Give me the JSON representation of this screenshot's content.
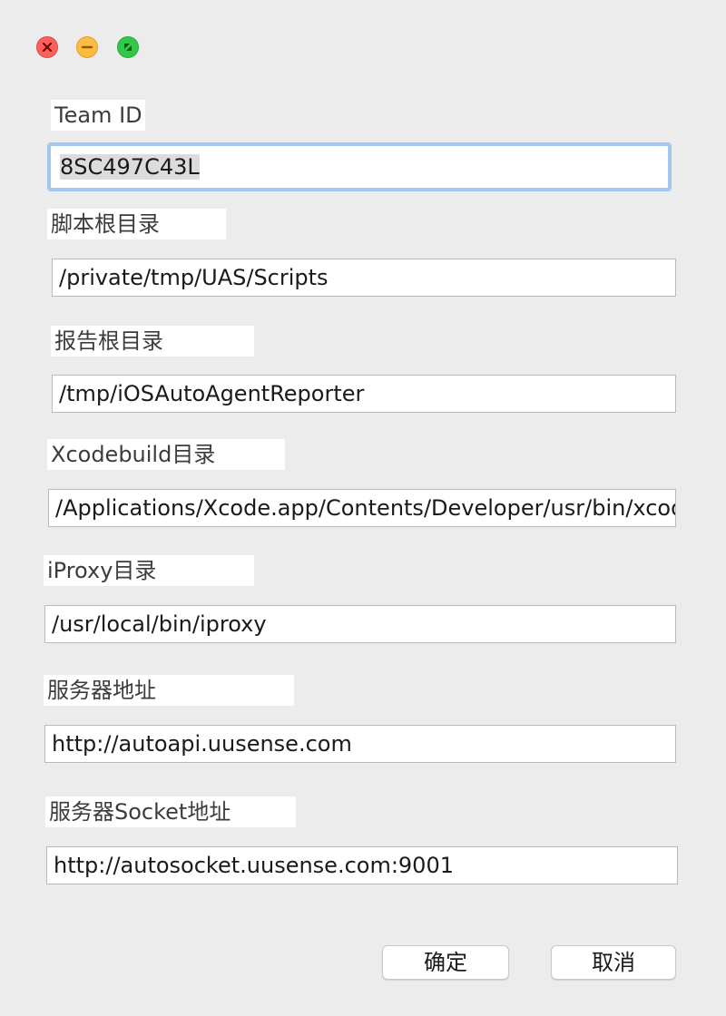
{
  "window": {
    "controls": {
      "close_icon": "close-icon",
      "minimize_icon": "minimize-icon",
      "maximize_icon": "maximize-icon"
    }
  },
  "form": {
    "team_id": {
      "label": "Team ID",
      "value": "8SC497C43L"
    },
    "script_root": {
      "label": "脚本根目录",
      "value": "/private/tmp/UAS/Scripts"
    },
    "report_root": {
      "label": "报告根目录",
      "value": "/tmp/iOSAutoAgentReporter"
    },
    "xcodebuild_dir": {
      "label": "Xcodebuild目录",
      "value": "/Applications/Xcode.app/Contents/Developer/usr/bin/xcodebuild"
    },
    "iproxy_dir": {
      "label": "iProxy目录",
      "value": "/usr/local/bin/iproxy"
    },
    "server_addr": {
      "label": "服务器地址",
      "value": "http://autoapi.uusense.com"
    },
    "socket_addr": {
      "label": "服务器Socket地址",
      "value": "http://autosocket.uusense.com:9001"
    }
  },
  "buttons": {
    "ok": "确定",
    "cancel": "取消"
  },
  "colors": {
    "background": "#ececec",
    "focus_ring": "#a3c8f0",
    "close": "#fc605c",
    "minimize": "#fdbc40",
    "maximize": "#34c84a"
  }
}
